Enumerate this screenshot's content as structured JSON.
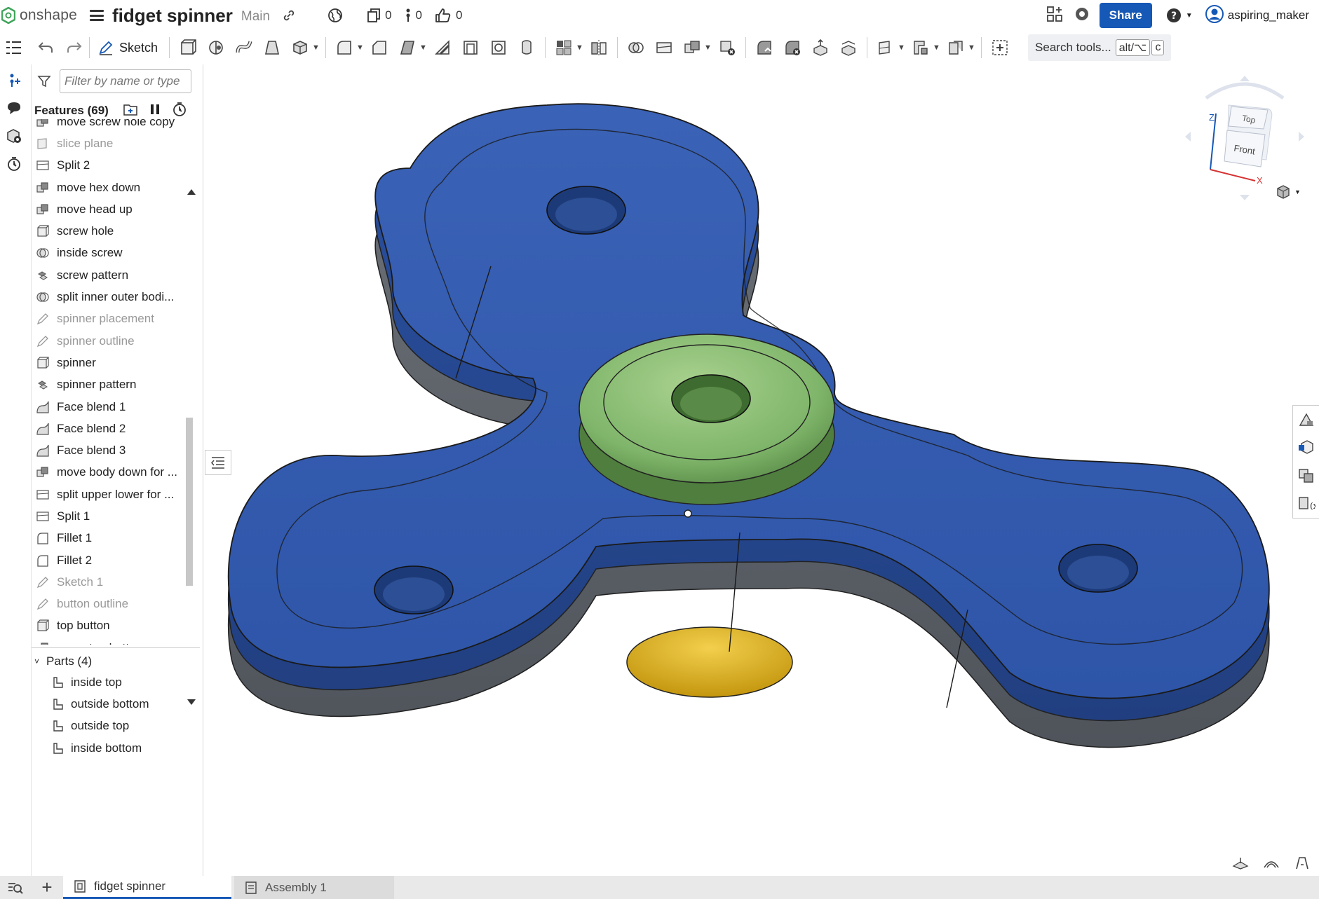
{
  "app": {
    "logo_text": "onshape",
    "document_title": "fidget spinner",
    "branch": "Main",
    "versions_count": "0",
    "branches_count": "0",
    "likes_count": "0",
    "share_label": "Share",
    "username": "aspiring_maker"
  },
  "toolbar": {
    "sketch_label": "Sketch",
    "search_label": "Search tools...",
    "search_shortcut_1": "alt/⌥",
    "search_shortcut_2": "c"
  },
  "feature_panel": {
    "filter_placeholder": "Filter by name or type",
    "header": "Features (69)",
    "items": [
      {
        "label": "move screw hole copy",
        "icon": "transform-icon",
        "suppressed": false
      },
      {
        "label": "slice plane",
        "icon": "plane-icon",
        "suppressed": true
      },
      {
        "label": "Split 2",
        "icon": "split-icon",
        "suppressed": false
      },
      {
        "label": "move hex down",
        "icon": "transform-icon",
        "suppressed": false
      },
      {
        "label": "move head up",
        "icon": "transform-icon",
        "suppressed": false
      },
      {
        "label": "screw hole",
        "icon": "extrude-icon",
        "suppressed": false
      },
      {
        "label": "inside screw",
        "icon": "boolean-icon",
        "suppressed": false
      },
      {
        "label": "screw pattern",
        "icon": "pattern-icon",
        "suppressed": false
      },
      {
        "label": "split inner outer bodi...",
        "icon": "boolean-icon",
        "suppressed": false
      },
      {
        "label": "spinner placement",
        "icon": "sketch-icon",
        "suppressed": true
      },
      {
        "label": "spinner outline",
        "icon": "sketch-icon",
        "suppressed": true
      },
      {
        "label": "spinner",
        "icon": "extrude-icon",
        "suppressed": false
      },
      {
        "label": "spinner pattern",
        "icon": "pattern-icon",
        "suppressed": false
      },
      {
        "label": "Face blend 1",
        "icon": "blend-icon",
        "suppressed": false
      },
      {
        "label": "Face blend 2",
        "icon": "blend-icon",
        "suppressed": false
      },
      {
        "label": "Face blend 3",
        "icon": "blend-icon",
        "suppressed": false
      },
      {
        "label": "move body down for ...",
        "icon": "transform-icon",
        "suppressed": false
      },
      {
        "label": "split upper lower for ...",
        "icon": "split-icon",
        "suppressed": false
      },
      {
        "label": "Split 1",
        "icon": "split-icon",
        "suppressed": false
      },
      {
        "label": "Fillet 1",
        "icon": "fillet-icon",
        "suppressed": false
      },
      {
        "label": "Fillet 2",
        "icon": "fillet-icon",
        "suppressed": false
      },
      {
        "label": "Sketch 1",
        "icon": "sketch-icon",
        "suppressed": true
      },
      {
        "label": "button outline",
        "icon": "sketch-icon",
        "suppressed": true
      },
      {
        "label": "top button",
        "icon": "extrude-icon",
        "suppressed": false
      },
      {
        "label": "move top button",
        "icon": "transform-icon",
        "suppressed": false
      }
    ],
    "parts_header": "Parts (4)",
    "parts": [
      {
        "label": "inside top"
      },
      {
        "label": "outside bottom"
      },
      {
        "label": "outside top"
      },
      {
        "label": "inside bottom"
      }
    ]
  },
  "viewcube": {
    "top_label": "Top",
    "front_label": "Front",
    "axis_z": "Z",
    "axis_x": "X"
  },
  "tabs": [
    {
      "label": "fidget spinner",
      "active": true
    },
    {
      "label": "Assembly 1",
      "active": false
    }
  ],
  "colors": {
    "accent": "#1658b6",
    "spinner_blue": "#2f56a8",
    "spinner_gray": "#5c6168",
    "bearing_green": "#7fb56a",
    "bearing_yellow": "#e0b62a"
  }
}
